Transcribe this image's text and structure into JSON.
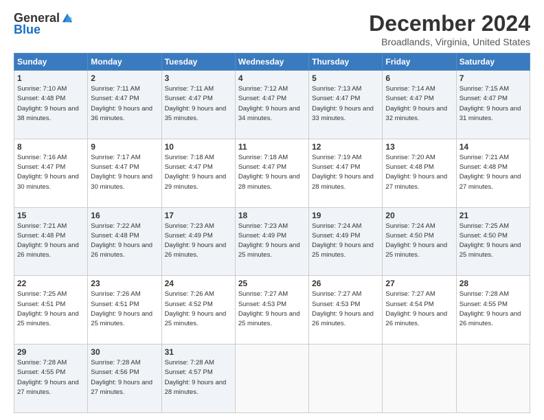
{
  "logo": {
    "general": "General",
    "blue": "Blue"
  },
  "title": "December 2024",
  "subtitle": "Broadlands, Virginia, United States",
  "header_days": [
    "Sunday",
    "Monday",
    "Tuesday",
    "Wednesday",
    "Thursday",
    "Friday",
    "Saturday"
  ],
  "weeks": [
    [
      {
        "day": "1",
        "sunrise": "Sunrise: 7:10 AM",
        "sunset": "Sunset: 4:48 PM",
        "daylight": "Daylight: 9 hours and 38 minutes."
      },
      {
        "day": "2",
        "sunrise": "Sunrise: 7:11 AM",
        "sunset": "Sunset: 4:47 PM",
        "daylight": "Daylight: 9 hours and 36 minutes."
      },
      {
        "day": "3",
        "sunrise": "Sunrise: 7:11 AM",
        "sunset": "Sunset: 4:47 PM",
        "daylight": "Daylight: 9 hours and 35 minutes."
      },
      {
        "day": "4",
        "sunrise": "Sunrise: 7:12 AM",
        "sunset": "Sunset: 4:47 PM",
        "daylight": "Daylight: 9 hours and 34 minutes."
      },
      {
        "day": "5",
        "sunrise": "Sunrise: 7:13 AM",
        "sunset": "Sunset: 4:47 PM",
        "daylight": "Daylight: 9 hours and 33 minutes."
      },
      {
        "day": "6",
        "sunrise": "Sunrise: 7:14 AM",
        "sunset": "Sunset: 4:47 PM",
        "daylight": "Daylight: 9 hours and 32 minutes."
      },
      {
        "day": "7",
        "sunrise": "Sunrise: 7:15 AM",
        "sunset": "Sunset: 4:47 PM",
        "daylight": "Daylight: 9 hours and 31 minutes."
      }
    ],
    [
      {
        "day": "8",
        "sunrise": "Sunrise: 7:16 AM",
        "sunset": "Sunset: 4:47 PM",
        "daylight": "Daylight: 9 hours and 30 minutes."
      },
      {
        "day": "9",
        "sunrise": "Sunrise: 7:17 AM",
        "sunset": "Sunset: 4:47 PM",
        "daylight": "Daylight: 9 hours and 30 minutes."
      },
      {
        "day": "10",
        "sunrise": "Sunrise: 7:18 AM",
        "sunset": "Sunset: 4:47 PM",
        "daylight": "Daylight: 9 hours and 29 minutes."
      },
      {
        "day": "11",
        "sunrise": "Sunrise: 7:18 AM",
        "sunset": "Sunset: 4:47 PM",
        "daylight": "Daylight: 9 hours and 28 minutes."
      },
      {
        "day": "12",
        "sunrise": "Sunrise: 7:19 AM",
        "sunset": "Sunset: 4:47 PM",
        "daylight": "Daylight: 9 hours and 28 minutes."
      },
      {
        "day": "13",
        "sunrise": "Sunrise: 7:20 AM",
        "sunset": "Sunset: 4:48 PM",
        "daylight": "Daylight: 9 hours and 27 minutes."
      },
      {
        "day": "14",
        "sunrise": "Sunrise: 7:21 AM",
        "sunset": "Sunset: 4:48 PM",
        "daylight": "Daylight: 9 hours and 27 minutes."
      }
    ],
    [
      {
        "day": "15",
        "sunrise": "Sunrise: 7:21 AM",
        "sunset": "Sunset: 4:48 PM",
        "daylight": "Daylight: 9 hours and 26 minutes."
      },
      {
        "day": "16",
        "sunrise": "Sunrise: 7:22 AM",
        "sunset": "Sunset: 4:48 PM",
        "daylight": "Daylight: 9 hours and 26 minutes."
      },
      {
        "day": "17",
        "sunrise": "Sunrise: 7:23 AM",
        "sunset": "Sunset: 4:49 PM",
        "daylight": "Daylight: 9 hours and 26 minutes."
      },
      {
        "day": "18",
        "sunrise": "Sunrise: 7:23 AM",
        "sunset": "Sunset: 4:49 PM",
        "daylight": "Daylight: 9 hours and 25 minutes."
      },
      {
        "day": "19",
        "sunrise": "Sunrise: 7:24 AM",
        "sunset": "Sunset: 4:49 PM",
        "daylight": "Daylight: 9 hours and 25 minutes."
      },
      {
        "day": "20",
        "sunrise": "Sunrise: 7:24 AM",
        "sunset": "Sunset: 4:50 PM",
        "daylight": "Daylight: 9 hours and 25 minutes."
      },
      {
        "day": "21",
        "sunrise": "Sunrise: 7:25 AM",
        "sunset": "Sunset: 4:50 PM",
        "daylight": "Daylight: 9 hours and 25 minutes."
      }
    ],
    [
      {
        "day": "22",
        "sunrise": "Sunrise: 7:25 AM",
        "sunset": "Sunset: 4:51 PM",
        "daylight": "Daylight: 9 hours and 25 minutes."
      },
      {
        "day": "23",
        "sunrise": "Sunrise: 7:26 AM",
        "sunset": "Sunset: 4:51 PM",
        "daylight": "Daylight: 9 hours and 25 minutes."
      },
      {
        "day": "24",
        "sunrise": "Sunrise: 7:26 AM",
        "sunset": "Sunset: 4:52 PM",
        "daylight": "Daylight: 9 hours and 25 minutes."
      },
      {
        "day": "25",
        "sunrise": "Sunrise: 7:27 AM",
        "sunset": "Sunset: 4:53 PM",
        "daylight": "Daylight: 9 hours and 25 minutes."
      },
      {
        "day": "26",
        "sunrise": "Sunrise: 7:27 AM",
        "sunset": "Sunset: 4:53 PM",
        "daylight": "Daylight: 9 hours and 26 minutes."
      },
      {
        "day": "27",
        "sunrise": "Sunrise: 7:27 AM",
        "sunset": "Sunset: 4:54 PM",
        "daylight": "Daylight: 9 hours and 26 minutes."
      },
      {
        "day": "28",
        "sunrise": "Sunrise: 7:28 AM",
        "sunset": "Sunset: 4:55 PM",
        "daylight": "Daylight: 9 hours and 26 minutes."
      }
    ],
    [
      {
        "day": "29",
        "sunrise": "Sunrise: 7:28 AM",
        "sunset": "Sunset: 4:55 PM",
        "daylight": "Daylight: 9 hours and 27 minutes."
      },
      {
        "day": "30",
        "sunrise": "Sunrise: 7:28 AM",
        "sunset": "Sunset: 4:56 PM",
        "daylight": "Daylight: 9 hours and 27 minutes."
      },
      {
        "day": "31",
        "sunrise": "Sunrise: 7:28 AM",
        "sunset": "Sunset: 4:57 PM",
        "daylight": "Daylight: 9 hours and 28 minutes."
      },
      null,
      null,
      null,
      null
    ]
  ]
}
